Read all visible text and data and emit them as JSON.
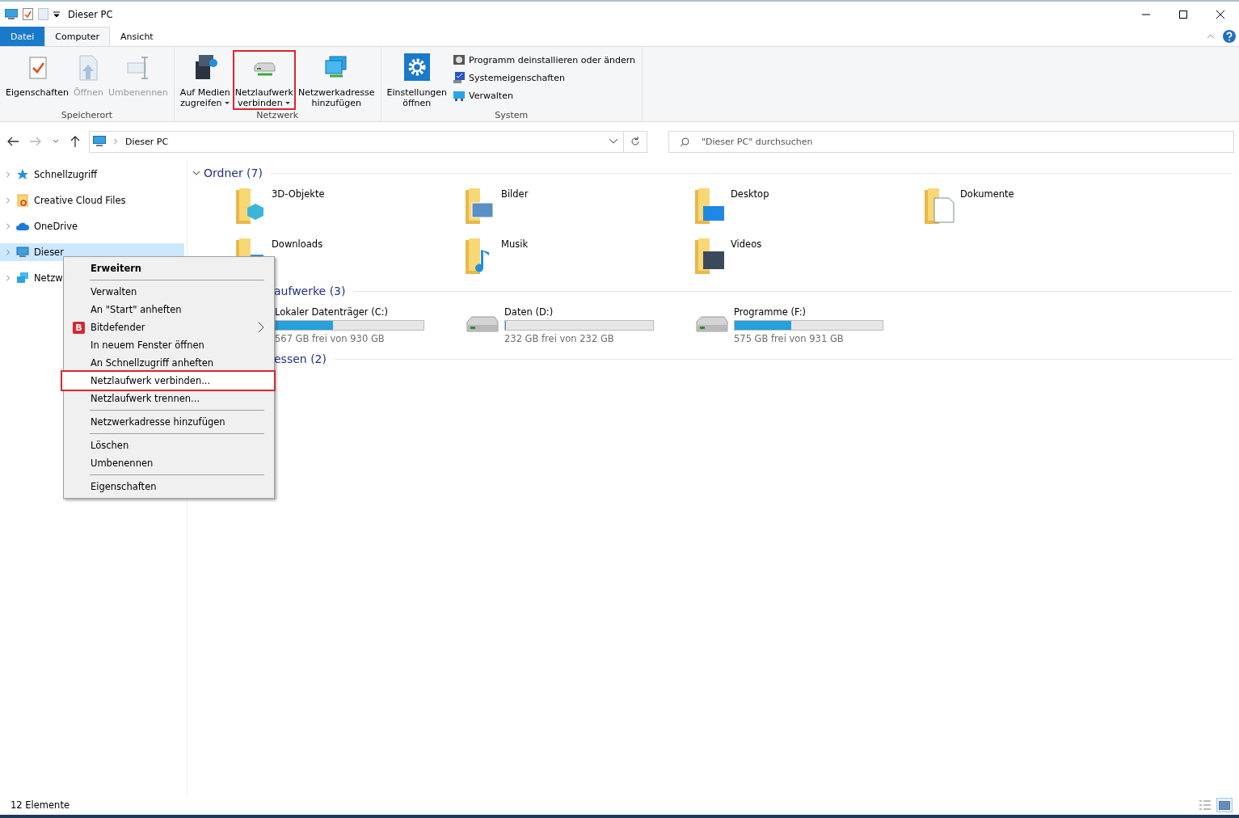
{
  "window": {
    "title": "Dieser PC"
  },
  "ribbon": {
    "tabs": [
      {
        "label": "Datei",
        "kind": "file",
        "selected": false
      },
      {
        "label": "Computer",
        "kind": "tab",
        "selected": true
      },
      {
        "label": "Ansicht",
        "kind": "tab",
        "selected": false
      }
    ],
    "groups": [
      {
        "label": "Speicherort",
        "items": [
          {
            "kind": "large",
            "lines": [
              "Eigenschaften"
            ],
            "disabled": false,
            "dropdown": false,
            "highlighted": false
          },
          {
            "kind": "large",
            "lines": [
              "Öffnen"
            ],
            "disabled": true,
            "dropdown": false,
            "highlighted": false
          },
          {
            "kind": "large",
            "lines": [
              "Umbenennen"
            ],
            "disabled": true,
            "dropdown": false,
            "highlighted": false
          }
        ]
      },
      {
        "label": "Netzwerk",
        "items": [
          {
            "kind": "large",
            "lines": [
              "Auf Medien",
              "zugreifen"
            ],
            "disabled": false,
            "dropdown": true,
            "highlighted": false
          },
          {
            "kind": "large",
            "lines": [
              "Netzlaufwerk",
              "verbinden"
            ],
            "disabled": false,
            "dropdown": true,
            "highlighted": true
          },
          {
            "kind": "large",
            "lines": [
              "Netzwerkadresse",
              "hinzufügen"
            ],
            "disabled": false,
            "dropdown": false,
            "highlighted": false
          }
        ]
      },
      {
        "label": "System",
        "items": [
          {
            "kind": "large",
            "lines": [
              "Einstellungen",
              "öffnen"
            ],
            "disabled": false,
            "dropdown": false,
            "highlighted": false
          },
          {
            "kind": "small",
            "lines": [
              "Programm deinstallieren oder ändern"
            ],
            "disabled": false,
            "dropdown": false,
            "highlighted": false
          },
          {
            "kind": "small",
            "lines": [
              "Systemeigenschaften"
            ],
            "disabled": false,
            "dropdown": false,
            "highlighted": false
          },
          {
            "kind": "small",
            "lines": [
              "Verwalten"
            ],
            "disabled": false,
            "dropdown": false,
            "highlighted": false
          }
        ]
      }
    ]
  },
  "address": {
    "path": "Dieser PC",
    "search_placeholder": "\"Dieser PC\" durchsuchen"
  },
  "nav_pane": {
    "items": [
      {
        "label": "Schnellzugriff",
        "selected": false
      },
      {
        "label": "Creative Cloud Files",
        "selected": false
      },
      {
        "label": "OneDrive",
        "selected": false
      },
      {
        "label": "Dieser",
        "selected": true
      },
      {
        "label": "Netzw",
        "selected": false
      }
    ]
  },
  "sections": [
    {
      "title": "Ordner (7)",
      "kind": "folders",
      "items": [
        {
          "name": "3D-Objekte"
        },
        {
          "name": "Bilder"
        },
        {
          "name": "Desktop"
        },
        {
          "name": "Dokumente"
        },
        {
          "name": "Downloads"
        },
        {
          "name": "Musik"
        },
        {
          "name": "Videos"
        }
      ]
    },
    {
      "title": "aufwerke (3)",
      "kind": "drives",
      "items": [
        {
          "name": "Lokaler Datenträger (C:)",
          "free": "567 GB frei von 930 GB",
          "level": 0.39
        },
        {
          "name": "Daten  (D:)",
          "free": "232 GB frei von 232 GB",
          "level": 0
        },
        {
          "name": "Programme (F:)",
          "free": "575 GB frei von 931 GB",
          "level": 0.38
        }
      ]
    },
    {
      "title": "essen (2)",
      "kind": "locations"
    }
  ],
  "context_menu": {
    "items": [
      {
        "kind": "header",
        "label": "Erweitern",
        "highlighted": false
      },
      {
        "kind": "separator"
      },
      {
        "kind": "item",
        "label": "Verwalten",
        "highlighted": false
      },
      {
        "kind": "item",
        "label": "An \"Start\" anheften",
        "highlighted": false
      },
      {
        "kind": "submenu",
        "label": "Bitdefender",
        "badge": "B",
        "highlighted": false
      },
      {
        "kind": "item",
        "label": "In neuem Fenster öffnen",
        "highlighted": false
      },
      {
        "kind": "item",
        "label": "An Schnellzugriff anheften",
        "highlighted": false
      },
      {
        "kind": "item",
        "label": "Netzlaufwerk verbinden...",
        "highlighted": true
      },
      {
        "kind": "item",
        "label": "Netzlaufwerk trennen...",
        "highlighted": false
      },
      {
        "kind": "separator"
      },
      {
        "kind": "item",
        "label": "Netzwerkadresse hinzufügen",
        "highlighted": false
      },
      {
        "kind": "separator"
      },
      {
        "kind": "item",
        "label": "Löschen",
        "highlighted": false
      },
      {
        "kind": "item",
        "label": "Umbenennen",
        "highlighted": false
      },
      {
        "kind": "separator"
      },
      {
        "kind": "item",
        "label": "Eigenschaften",
        "highlighted": false
      }
    ]
  },
  "status_bar": {
    "count": "12 Elemente",
    "views": [
      {
        "selected": false
      },
      {
        "selected": true
      }
    ]
  }
}
